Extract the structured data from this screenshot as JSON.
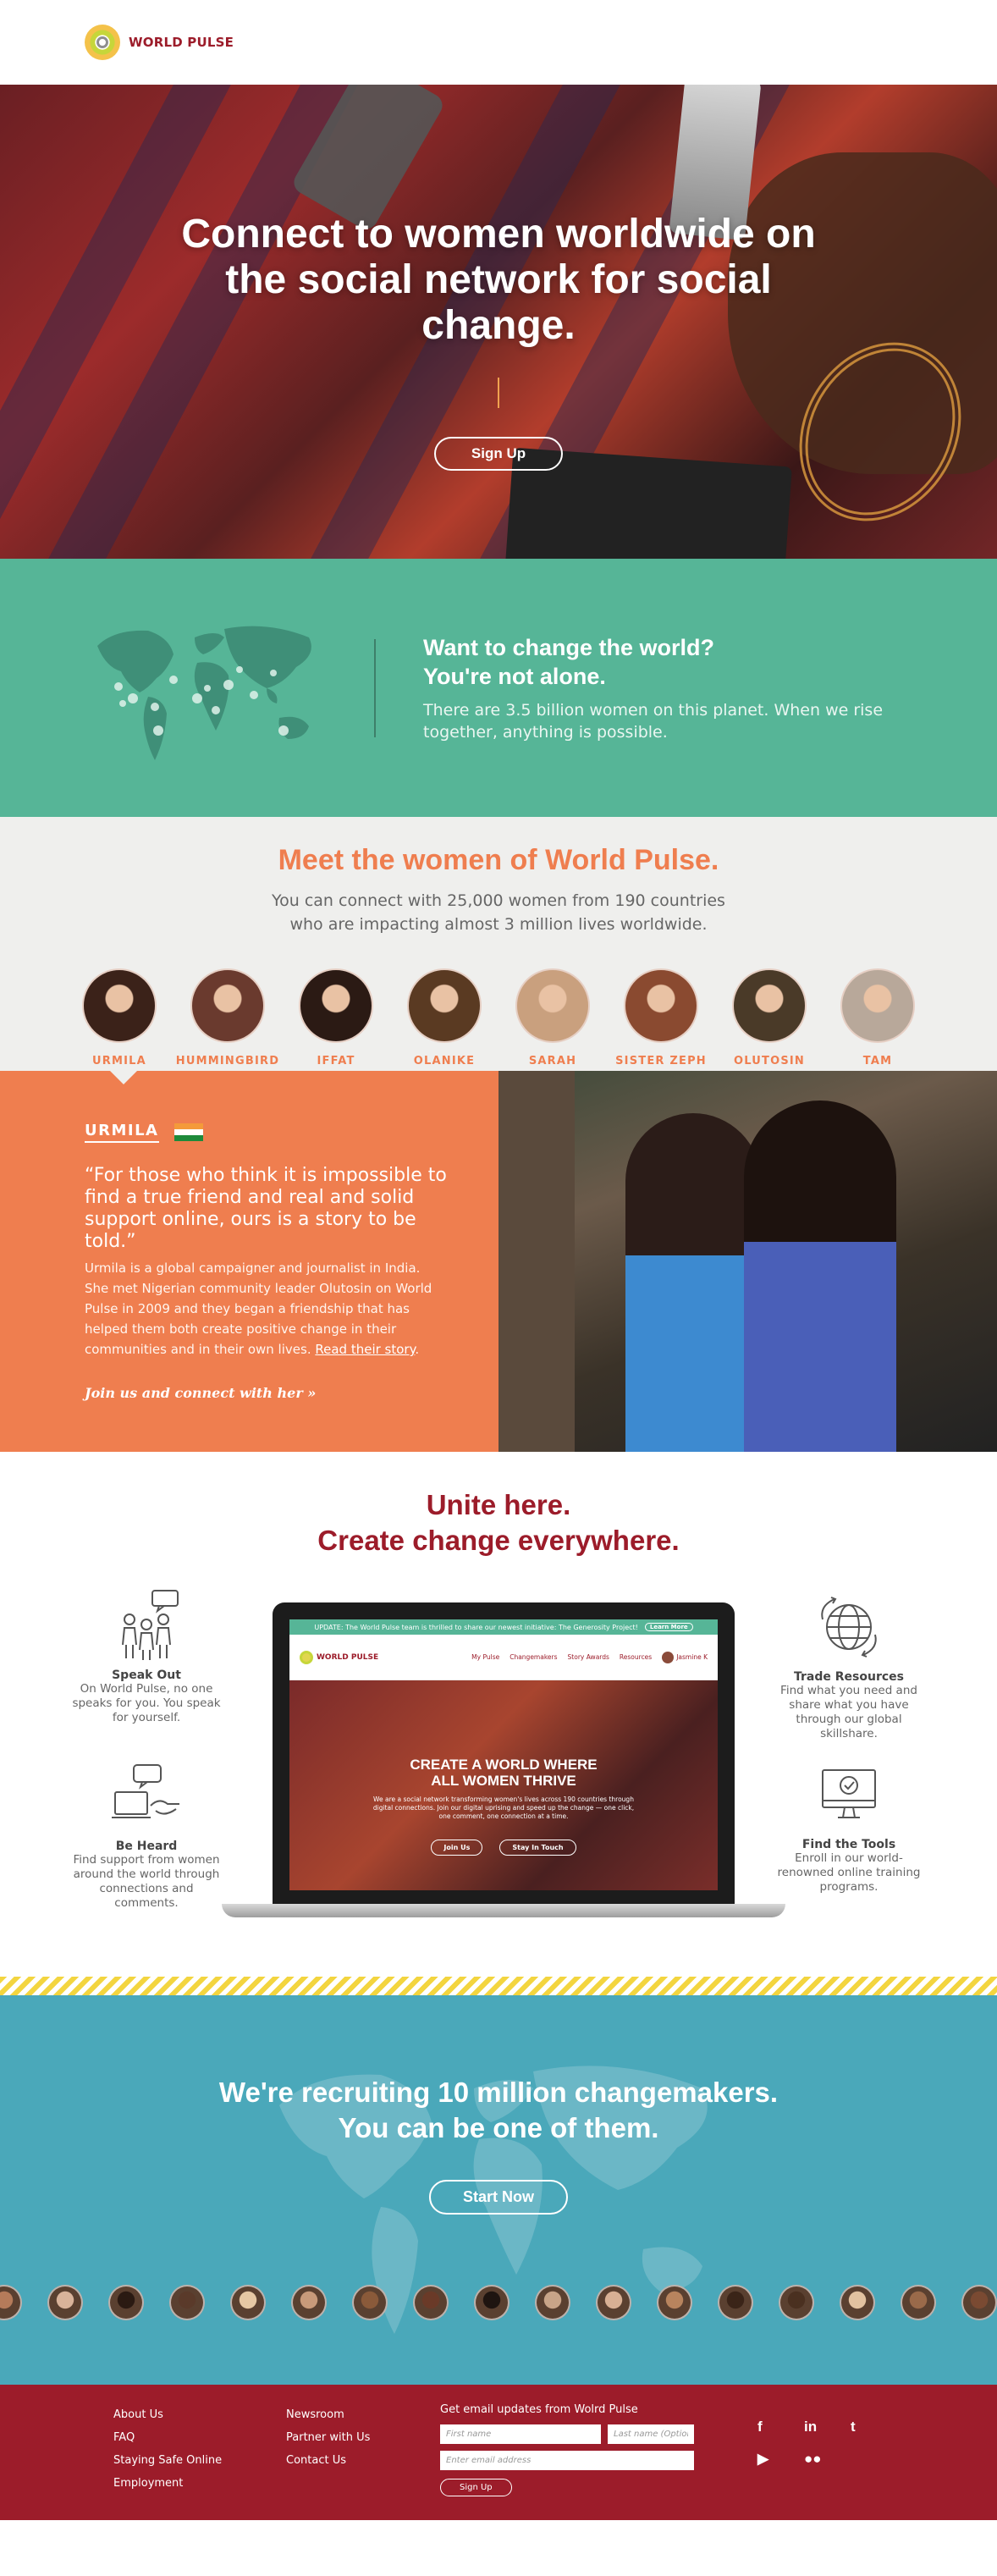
{
  "header": {
    "brand": "WORLD PULSE"
  },
  "hero": {
    "title": "Connect to women worldwide on the social network for social change.",
    "cta_label": "Sign Up"
  },
  "alone": {
    "title_line1": "Want to change the world?",
    "title_line2": "You're not alone.",
    "body": "There are 3.5 billion women on this planet. When we rise together, anything is possible."
  },
  "meet": {
    "title": "Meet the women of World Pulse.",
    "subtitle_line1": "You can connect with 25,000 women from 190 countries",
    "subtitle_line2": "who are impacting almost 3 million lives worldwide.",
    "women": [
      {
        "name": "URMILA",
        "color": "#3b2219"
      },
      {
        "name": "HUMMINGBIRD",
        "color": "#6a3a2e"
      },
      {
        "name": "IFFAT",
        "color": "#2b1a14"
      },
      {
        "name": "OLANIKE",
        "color": "#5a3a22"
      },
      {
        "name": "SARAH",
        "color": "#c9a07e"
      },
      {
        "name": "SISTER ZEPH",
        "color": "#8a4a30"
      },
      {
        "name": "OLUTOSIN",
        "color": "#4a3a28"
      },
      {
        "name": "TAM",
        "color": "#b8a89a"
      }
    ]
  },
  "story": {
    "name": "URMILA",
    "quote": "“For those who think it is impossible to find a true friend and real and solid support online, ours is a story to be told.”",
    "body": "Urmila is a global campaigner and journalist in India. She met Nigerian community leader Olutosin on World Pulse in 2009 and they began a friendship that has helped them both create positive change in their communities and in their own lives.",
    "link": "Read their story",
    "cta": "Join us and connect with her »",
    "flag_colors": [
      "#f49a3a",
      "#ffffff",
      "#1e8a3a"
    ]
  },
  "unite": {
    "title_line1": "Unite here.",
    "title_line2": "Create change everywhere.",
    "features": {
      "speak": {
        "title": "Speak Out",
        "body": "On World Pulse, no one speaks for you. You speak for yourself."
      },
      "heard": {
        "title": "Be Heard",
        "body": "Find support from women around the world through connections and comments."
      },
      "trade": {
        "title": "Trade Resources",
        "body": "Find what you need and share what you have through our global skillshare."
      },
      "tools": {
        "title": "Find the Tools",
        "body": "Enroll in our world-renowned online training programs."
      }
    },
    "screen": {
      "banner": "UPDATE: The World Pulse team is thrilled to share our newest initiative: The Generosity Project!",
      "banner_btn": "Learn More",
      "brand": "WORLD PULSE",
      "nav": [
        "My Pulse",
        "Changemakers",
        "Story Awards",
        "Resources",
        "Jasmine K"
      ],
      "headline_line1": "CREATE A WORLD WHERE",
      "headline_line2": "ALL WOMEN THRIVE",
      "body": "We are a social network transforming women's lives across 190 countries through digital connections. Join our digital uprising and speed up the change — one click, one comment, one connection at a time.",
      "btn1": "Join Us",
      "btn2": "Stay In Touch"
    }
  },
  "recruit": {
    "title_line1": "We're recruiting 10 million changemakers.",
    "title_line2": "You can be one of them.",
    "cta": "Start Now",
    "face_colors": [
      "#b57b5a",
      "#d9b39a",
      "#2a1a12",
      "#5a3a2a",
      "#e6c8a4",
      "#c89a7a",
      "#8a5a3a",
      "#6a3a28",
      "#1e1410",
      "#c8a488",
      "#d8b094",
      "#b8845e",
      "#3a2418",
      "#4a3020",
      "#e2c2a0",
      "#9a6a4a",
      "#7a4a32"
    ]
  },
  "footer": {
    "col1": [
      "About Us",
      "FAQ",
      "Staying Safe Online",
      "Employment"
    ],
    "col2": [
      "Newsroom",
      "Partner with Us",
      "Contact Us"
    ],
    "signup_label": "Get email updates from Wolrd Pulse",
    "first_placeholder": "First name",
    "last_placeholder": "Last name (Optional)",
    "email_placeholder": "Enter email address",
    "signup_button": "Sign Up",
    "social": [
      "f",
      "in",
      "t",
      "▶",
      "●●"
    ]
  }
}
